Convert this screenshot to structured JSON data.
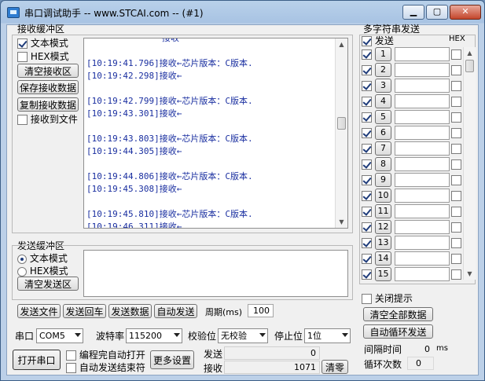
{
  "window": {
    "title": "串口调试助手 -- www.STCAI.com -- (#1)",
    "min_icon": "minimize-icon",
    "max_icon": "maximize-icon",
    "close_icon": "close-icon",
    "min_glyph": "▁",
    "max_glyph": "▢",
    "close_glyph": "✕"
  },
  "receive": {
    "group_title": "接收缓冲区",
    "text_mode": "文本模式",
    "hex_mode": "HEX模式",
    "clear_btn": "清空接收区",
    "save_btn": "保存接收数据",
    "copy_btn": "复制接收数据",
    "to_file": "接收到文件",
    "text_mode_checked": true,
    "hex_mode_checked": false,
    "to_file_checked": false,
    "top_partial": "接收",
    "lines": [
      "",
      "[10:19:41.796]接收←芯片版本：C版本.",
      "[10:19:42.298]接收←",
      "",
      "[10:19:42.799]接收←芯片版本：C版本.",
      "[10:19:43.301]接收←",
      "",
      "[10:19:43.803]接收←芯片版本：C版本.",
      "[10:19:44.305]接收←",
      "",
      "[10:19:44.806]接收←芯片版本：C版本.",
      "[10:19:45.308]接收←",
      "",
      "[10:19:45.810]接收←芯片版本：C版本.",
      "[10:19:46.311]接收←"
    ]
  },
  "send": {
    "group_title": "发送缓冲区",
    "text_mode": "文本模式",
    "hex_mode": "HEX模式",
    "clear_btn": "清空发送区",
    "text_mode_selected": true,
    "send_file": "发送文件",
    "send_return": "发送回车",
    "send_data": "发送数据",
    "auto_send": "自动发送",
    "period_label": "周期(ms)",
    "period_value": "100"
  },
  "serial": {
    "port_label": "串口",
    "port_value": "COM5",
    "baud_label": "波特率",
    "baud_value": "115200",
    "parity_label": "校验位",
    "parity_value": "无校验",
    "stop_label": "停止位",
    "stop_value": "1位",
    "open_btn": "打开串口",
    "auto_open": "编程完自动打开",
    "auto_end": "自动发送结束符",
    "more_btn": "更多设置",
    "send_label": "发送",
    "send_count": "0",
    "recv_label": "接收",
    "recv_count": "1071",
    "clear_count_btn": "清零"
  },
  "multi": {
    "group_title": "多字符串发送",
    "send_header": "发送",
    "hex_header": "HEX",
    "rows": [
      {
        "num": "1",
        "checked": true
      },
      {
        "num": "2",
        "checked": true
      },
      {
        "num": "3",
        "checked": true
      },
      {
        "num": "4",
        "checked": true
      },
      {
        "num": "5",
        "checked": true
      },
      {
        "num": "6",
        "checked": true
      },
      {
        "num": "7",
        "checked": true
      },
      {
        "num": "8",
        "checked": true
      },
      {
        "num": "9",
        "checked": true
      },
      {
        "num": "10",
        "checked": true
      },
      {
        "num": "11",
        "checked": true
      },
      {
        "num": "12",
        "checked": true
      },
      {
        "num": "13",
        "checked": true
      },
      {
        "num": "14",
        "checked": true
      },
      {
        "num": "15",
        "checked": true
      }
    ],
    "close_tip": "关闭提示",
    "clear_all": "清空全部数据",
    "auto_loop": "自动循环发送",
    "interval_label": "间隔时间",
    "interval_value": "0",
    "interval_unit": "ms",
    "loop_label": "循环次数",
    "loop_value": "0"
  }
}
